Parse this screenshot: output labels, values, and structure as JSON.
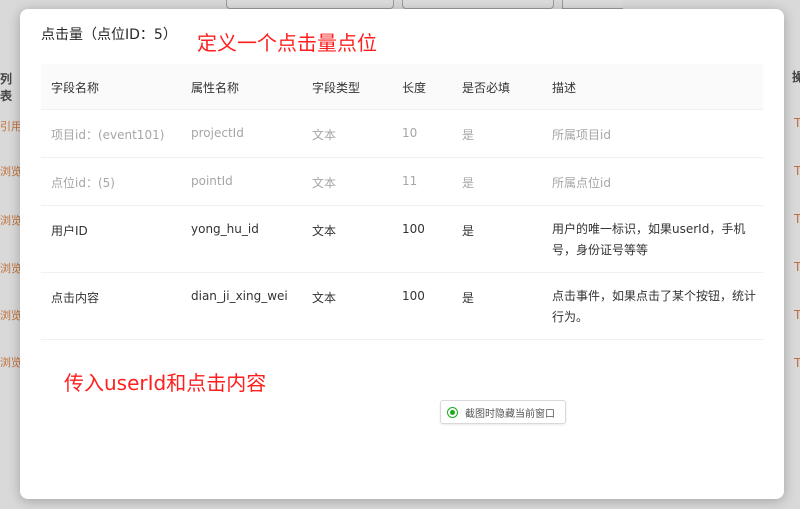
{
  "modal": {
    "title": "点击量（点位ID：5）"
  },
  "annotations": {
    "top": "定义一个点击量点位",
    "bottom": "传入userId和点击内容"
  },
  "table": {
    "headers": [
      "字段名称",
      "属性名称",
      "字段类型",
      "长度",
      "是否必填",
      "描述"
    ],
    "rows": [
      {
        "field": "项目id：(event101)",
        "attr": "projectId",
        "type": "文本",
        "length": "10",
        "required": "是",
        "desc": "所属项目id"
      },
      {
        "field": "点位id：(5)",
        "attr": "pointId",
        "type": "文本",
        "length": "11",
        "required": "是",
        "desc": "所属点位id"
      },
      {
        "field": "用户ID",
        "attr": "yong_hu_id",
        "type": "文本",
        "length": "100",
        "required": "是",
        "desc": "用户的唯一标识，如果userId，手机号，身份证号等等"
      },
      {
        "field": "点击内容",
        "attr": "dian_ji_xing_wei",
        "type": "文本",
        "length": "100",
        "required": "是",
        "desc": "点击事件，如果点击了某个按钮，统计行为。"
      }
    ]
  },
  "capture_option": {
    "label": "截图时隐藏当前窗口"
  },
  "background": {
    "left_header": "列表",
    "left_links": [
      "引用数",
      "浏览量",
      "浏览量",
      "浏览量",
      "浏览量",
      "浏览量"
    ],
    "right_header": "操",
    "right_links": [
      "T",
      "T",
      "T",
      "T",
      "T",
      "T"
    ]
  },
  "colors": {
    "annotation": "#ff1f1f",
    "radio_accent": "#1aad19"
  }
}
